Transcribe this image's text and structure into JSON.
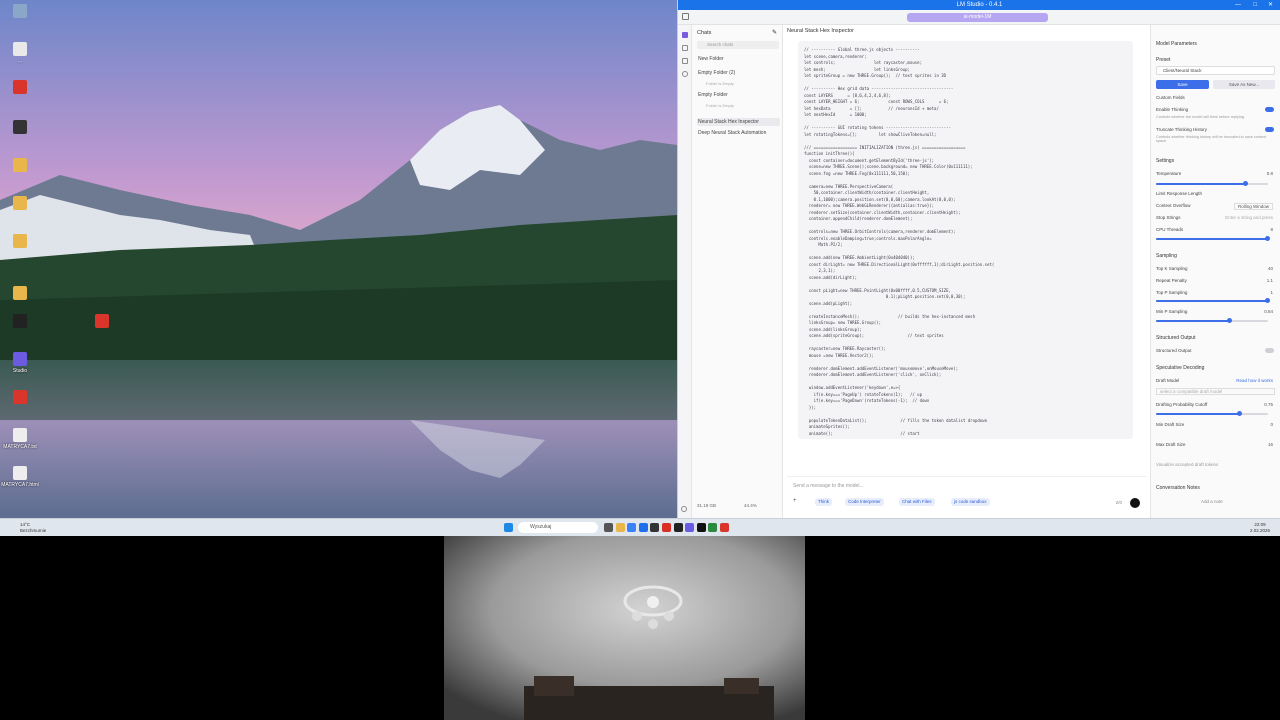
{
  "desktop": {
    "icons": [
      {
        "label": "",
        "color": "#8aa7c9"
      },
      {
        "label": "...",
        "color": "#e9e9e9"
      },
      {
        "label": "",
        "color": "#d9352b"
      },
      {
        "label": "",
        "color": "#333333"
      },
      {
        "label": "",
        "color": "#e8b64a"
      },
      {
        "label": "",
        "color": "#e8b64a"
      },
      {
        "label": "",
        "color": "#e8b64a"
      },
      {
        "label": "",
        "color": "#e8b64a"
      },
      {
        "label": "",
        "color": "#222222"
      },
      {
        "label": "Studio",
        "color": "#6b5be0"
      },
      {
        "label": "",
        "color": "#d9352b"
      },
      {
        "label": "MATRYCA7.txt",
        "color": "#eeeeee"
      },
      {
        "label": "MATRYCA7.html",
        "color": "#eeeeee"
      }
    ],
    "extra_icon": {
      "label": "",
      "color": "#d9352b"
    }
  },
  "lm": {
    "window_title": "LM Studio - 0.4.1",
    "model_pill": "ai-model-1M",
    "chats_header": "Chats",
    "search_placeholder": "Search chats",
    "new_folder": "New Folder",
    "folder1": "Empty Folder (2)",
    "folder1_sub": "Folder is Empty",
    "folder2": "Empty Folder",
    "folder2_sub": "Folder is Empty",
    "chat_active": "Neural Stack Hex Inspector",
    "chat_other": "Deep Neural Stack Automation",
    "chat_title": "Neural Stack Hex Inspector",
    "message_placeholder": "Send a message to the model...",
    "chips": [
      "Think",
      "Code Interpreter",
      "Chat with Files",
      "js code sandbox"
    ],
    "token_count": "2/0",
    "code_lines": [
      "// ---------- Global three.js objects ----------",
      "let scene,camera,renderer;",
      "let controls;                let raycaster,mouse;",
      "let mesh;                    let linksGroup;",
      "let spriteGroup = new THREE.Group();  // text sprites in 3D",
      "",
      "// ---------- Hex grid data ----------------------------------",
      "const LAYERS      = [8,6,4,2,4,6,8];",
      "const LAYER_HEIGHT = 6;            const ROWS_COLS      = 6;",
      "let hexData        = [];           // /neuronsId + meta/",
      "let nextHexId      = 1000;",
      "",
      "// ---------- GUI rotating tokens ---------------------------",
      "let rotatingTokens=[];         let showCliveToken=null;",
      "",
      "/// ================== INITIALIZATION (three.js) ==================",
      "function initThree(){",
      "  const container=document.getElementById('three-js');",
      "  scene=new THREE.Scene();scene.background= new THREE.Color(0x111111);",
      "  scene.fog =new THREE.Fog(0x111111,50,150);",
      "",
      "  camera=new THREE.PerspectiveCamera(",
      "    50,container.clientWidth/container.clientHeight,",
      "    0.1,1000);camera.position.set(0,0,60);camera.lookAt(0,0,0);",
      "  renderer= new THREE.WebGLRenderer({antialias:true});",
      "  renderer.setSize(container.clientWidth,container.clientHeight);",
      "  container.appendChild(renderer.domElement);",
      "",
      "  controls=new THREE.OrbitControls(camera,renderer.domElement);",
      "  controls.enableDamping=true;controls.maxPolarAngle=",
      "      Math.PI/2;",
      "",
      "  scene.add(new THREE.AmbientLight(0x404040));",
      "  const dirLight= new THREE.DirectionalLight(0xffffff,1);dirLight.position.set(",
      "      2,3,1);",
      "  scene.add(dirLight);",
      "",
      "  const pLight=new THREE.PointLight(0x00ffff,0.5,CUSTOM_SIZE,",
      "                                  0.1);pLight.position.set(0,0,30);",
      "  scene.add(pLight);",
      "",
      "  createInstanceMesh();                // builds the hex-instanced mesh",
      "  linksGroup= new THREE.Group();",
      "  scene.add(linksGroup);",
      "  scene.add(spriteGroup);                  // text sprites",
      "",
      "  raycaster=new THREE.Raycaster();",
      "  mouse =new THREE.Vector2();",
      "",
      "  renderer.domElement.addEventListener('mousemove',onMouseMove);",
      "  renderer.domElement.addEventListener('click', onClick);",
      "",
      "  window.addEventListener('keydown',e=>{",
      "    if(e.key==='PageUp') rotateTokens(1);   // up",
      "    if(e.key==='PageDown')rotateTokens(-1);  // down",
      "  });",
      "",
      "  populateTokenDataList();              // fills the token datalist dropdown",
      "  animateSprites();",
      "  animate();                            // start"
    ],
    "right": {
      "title": "Model Parameters",
      "preset_label": "Preset",
      "preset_value": "Client/Neural Stack",
      "save": "Save",
      "save_as": "Save As New...",
      "thinking_header": "Custom Fields",
      "enable_thinking": "Enable Thinking",
      "enable_thinking_desc": "Controls whether the model will think before replying",
      "truncate_thinking": "Truncate Thinking History",
      "truncate_desc": "Controls whether thinking history will be truncated to save context space",
      "settings": "Settings",
      "temperature": "Temperature",
      "temperature_val": "0.8",
      "temperature_frac": 0.8,
      "limit_response": "Limit Response Length",
      "context_overflow": "Context Overflow",
      "context_overflow_val": "Rolling Window",
      "stop_strings": "Stop Strings",
      "stop_placeholder": "Enter a string and press",
      "cpu_threads": "CPU Threads",
      "cpu_val": "8",
      "cpu_frac": 1.0,
      "sampling": "Sampling",
      "top_k": "Top K Sampling",
      "top_k_val": "40",
      "repeat_penalty": "Repeat Penalty",
      "repeat_val": "1.1",
      "top_p": "Top P Sampling",
      "top_p_val": "1",
      "top_p_frac": 1.0,
      "min_p": "Min P Sampling",
      "min_p_val": "0.84",
      "min_p_frac": 0.66,
      "structured": "Structured Output",
      "structured_label": "Structured Output",
      "spec": "Speculative Decoding",
      "draft_model": "Draft Model",
      "read_how": "Read how it works",
      "draft_placeholder": "select a compatible draft model",
      "drafting_prob": "Drafting Probability Cutoff",
      "drafting_val": "0.75",
      "drafting_frac": 0.75,
      "min_draft": "Min Draft Size",
      "min_draft_val": "0",
      "max_draft": "Max Draft Size",
      "max_draft_val": "16",
      "visualize": "Visualize accepted draft tokens",
      "notes": "Conversation Notes",
      "add_note": "Add a note"
    },
    "status": {
      "ram": "31.18 GB",
      "cpu": "44.4%"
    }
  },
  "taskbar": {
    "weather_temp": "14°C",
    "weather_desc": "Bezchmurnie",
    "search_placeholder": "Wyszukaj",
    "time": "22:09",
    "date": "2.02.2026"
  }
}
